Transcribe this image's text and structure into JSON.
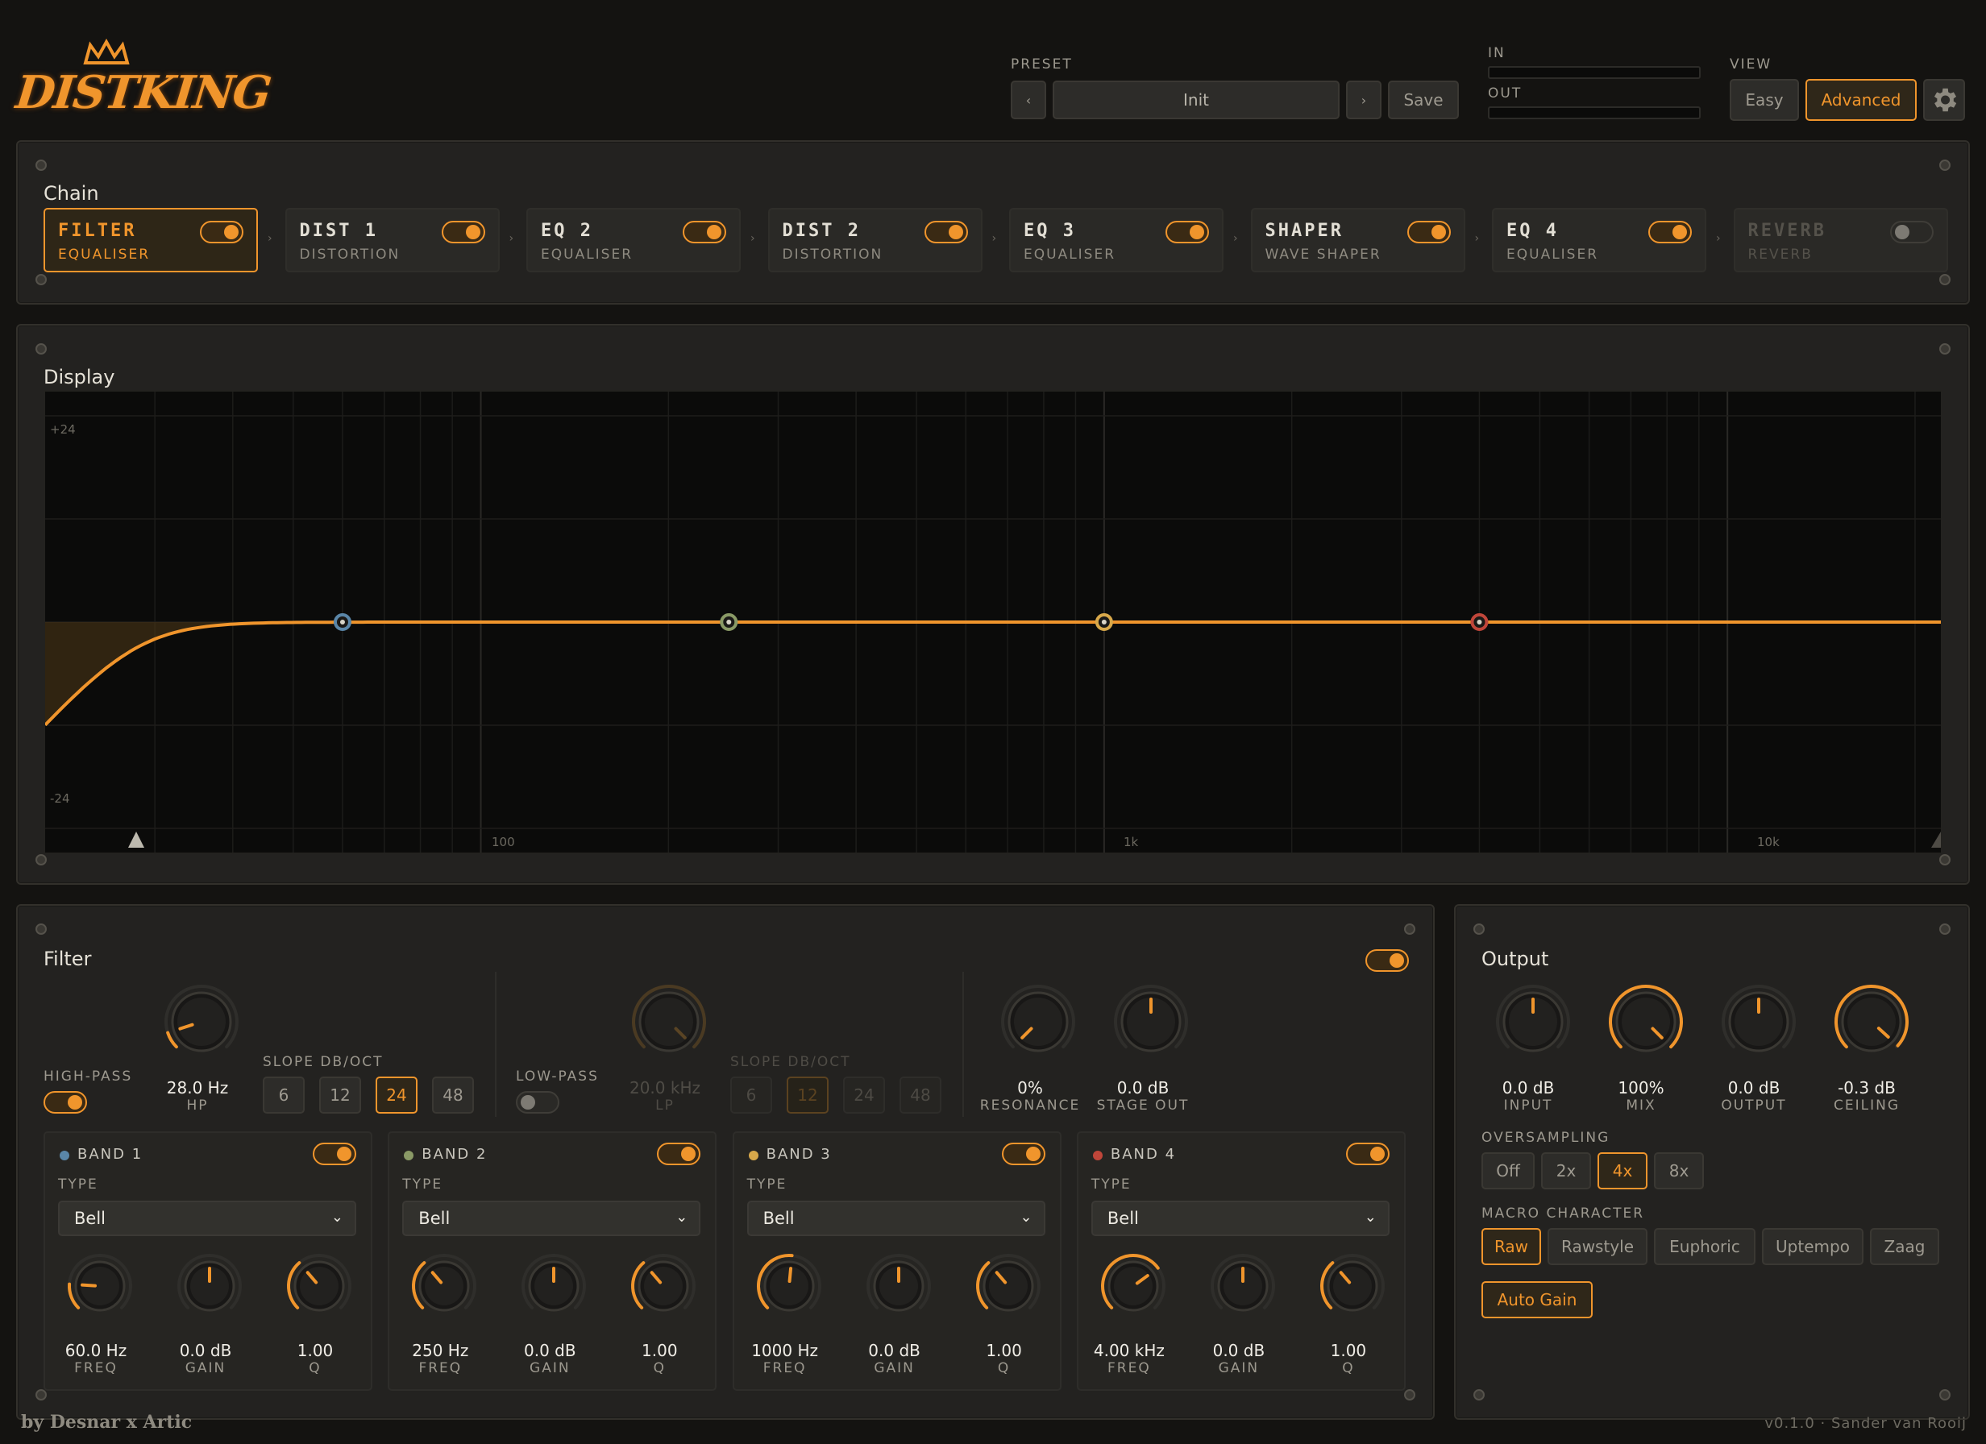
{
  "app": {
    "logo_text": "DISTKING",
    "credit": "by Desnar x Artic",
    "version": "v0.1.0 · Sander van Rooij"
  },
  "header": {
    "preset_label": "PRESET",
    "preset_prev": "‹",
    "preset_name": "Init",
    "preset_next": "›",
    "save_label": "Save",
    "in_label": "IN",
    "out_label": "OUT",
    "view_label": "VIEW",
    "easy_label": "Easy",
    "advanced_label": "Advanced",
    "settings_icon": "gear-icon"
  },
  "chain": {
    "title": "Chain",
    "items": [
      {
        "name": "FILTER",
        "sub": "EQUALISER",
        "enabled": true,
        "selected": true
      },
      {
        "name": "DIST 1",
        "sub": "DISTORTION",
        "enabled": true
      },
      {
        "name": "EQ 2",
        "sub": "EQUALISER",
        "enabled": true
      },
      {
        "name": "DIST 2",
        "sub": "DISTORTION",
        "enabled": true
      },
      {
        "name": "EQ 3",
        "sub": "EQUALISER",
        "enabled": true
      },
      {
        "name": "SHAPER",
        "sub": "WAVE SHAPER",
        "enabled": true
      },
      {
        "name": "EQ 4",
        "sub": "EQUALISER",
        "enabled": true
      },
      {
        "name": "REVERB",
        "sub": "REVERB",
        "enabled": false
      }
    ],
    "arrow": "›"
  },
  "display": {
    "title": "Display",
    "y_top": "+24",
    "y_bottom": "-24",
    "x_ticks": [
      "100",
      "1k",
      "10k"
    ],
    "nodes": [
      {
        "name": "band-1",
        "freq_hz": 60,
        "color": "#5a86a8"
      },
      {
        "name": "band-2",
        "freq_hz": 250,
        "color": "#8a9a66"
      },
      {
        "name": "band-3",
        "freq_hz": 1000,
        "color": "#d8a84a"
      },
      {
        "name": "band-4",
        "freq_hz": 4000,
        "color": "#c0463a"
      }
    ]
  },
  "filter": {
    "title": "Filter",
    "highpass_label": "HIGH-PASS",
    "hp": {
      "value": "28.0 Hz",
      "name": "HP"
    },
    "slope_label": "SLOPE DB/OCT",
    "hp_slopes": [
      "6",
      "12",
      "24",
      "48"
    ],
    "hp_slope_selected": "24",
    "lowpass_label": "LOW-PASS",
    "lp": {
      "value": "20.0 kHz",
      "name": "LP"
    },
    "lp_slopes": [
      "6",
      "12",
      "24",
      "48"
    ],
    "lp_slope_selected": "12",
    "resonance": {
      "value": "0%",
      "name": "RESONANCE"
    },
    "stage_out": {
      "value": "0.0 dB",
      "name": "STAGE OUT"
    }
  },
  "bands": [
    {
      "title": "BAND 1",
      "color": "#5a86a8",
      "type_label": "TYPE",
      "type": "Bell",
      "freq": "60.0 Hz",
      "gain": "0.0 dB",
      "q": "1.00"
    },
    {
      "title": "BAND 2",
      "color": "#8a9a66",
      "type_label": "TYPE",
      "type": "Bell",
      "freq": "250 Hz",
      "gain": "0.0 dB",
      "q": "1.00"
    },
    {
      "title": "BAND 3",
      "color": "#d8a84a",
      "type_label": "TYPE",
      "type": "Bell",
      "freq": "1000 Hz",
      "gain": "0.0 dB",
      "q": "1.00"
    },
    {
      "title": "BAND 4",
      "color": "#c0463a",
      "type_label": "TYPE",
      "type": "Bell",
      "freq": "4.00 kHz",
      "gain": "0.0 dB",
      "q": "1.00"
    }
  ],
  "band_labels": {
    "freq": "FREQ",
    "gain": "GAIN",
    "q": "Q"
  },
  "output": {
    "title": "Output",
    "input": {
      "value": "0.0 dB",
      "name": "INPUT"
    },
    "mix": {
      "value": "100%",
      "name": "MIX"
    },
    "output": {
      "value": "0.0 dB",
      "name": "OUTPUT"
    },
    "ceiling": {
      "value": "-0.3 dB",
      "name": "CEILING"
    },
    "oversampling_label": "OVERSAMPLING",
    "oversampling": [
      "Off",
      "2x",
      "4x",
      "8x"
    ],
    "oversampling_selected": "4x",
    "macro_label": "MACRO CHARACTER",
    "macros": [
      "Raw",
      "Rawstyle",
      "Euphoric",
      "Uptempo",
      "Zaag"
    ],
    "macro_selected": "Raw",
    "auto_gain_label": "Auto Gain"
  },
  "colors": {
    "accent": "#f0952c"
  }
}
